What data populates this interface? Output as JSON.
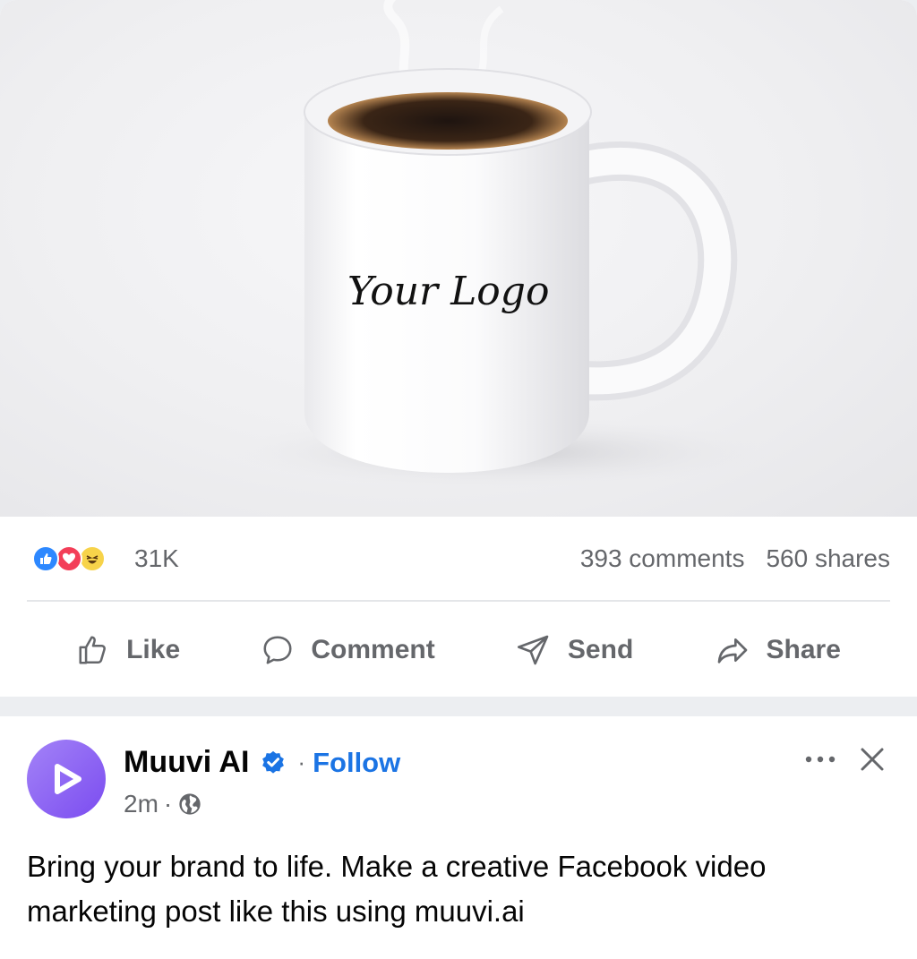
{
  "post_image": {
    "mug_logo_text": "Your Logo"
  },
  "stats": {
    "reaction_icons": [
      "like-icon",
      "love-icon",
      "haha-icon"
    ],
    "reaction_count": "31K",
    "comments": "393 comments",
    "shares": "560 shares"
  },
  "actions": {
    "like": "Like",
    "comment": "Comment",
    "send": "Send",
    "share": "Share"
  },
  "post": {
    "page_name": "Muuvi AI",
    "separator": "·",
    "follow": "Follow",
    "time": "2m",
    "audience_icon": "globe-icon",
    "text": "Bring your brand to life. Make a creative Facebook video marketing post like this using muuvi.ai"
  },
  "colors": {
    "brand_blue": "#1b74e4",
    "secondary_text": "#65676b",
    "avatar_purple": "#7b4cf0"
  }
}
